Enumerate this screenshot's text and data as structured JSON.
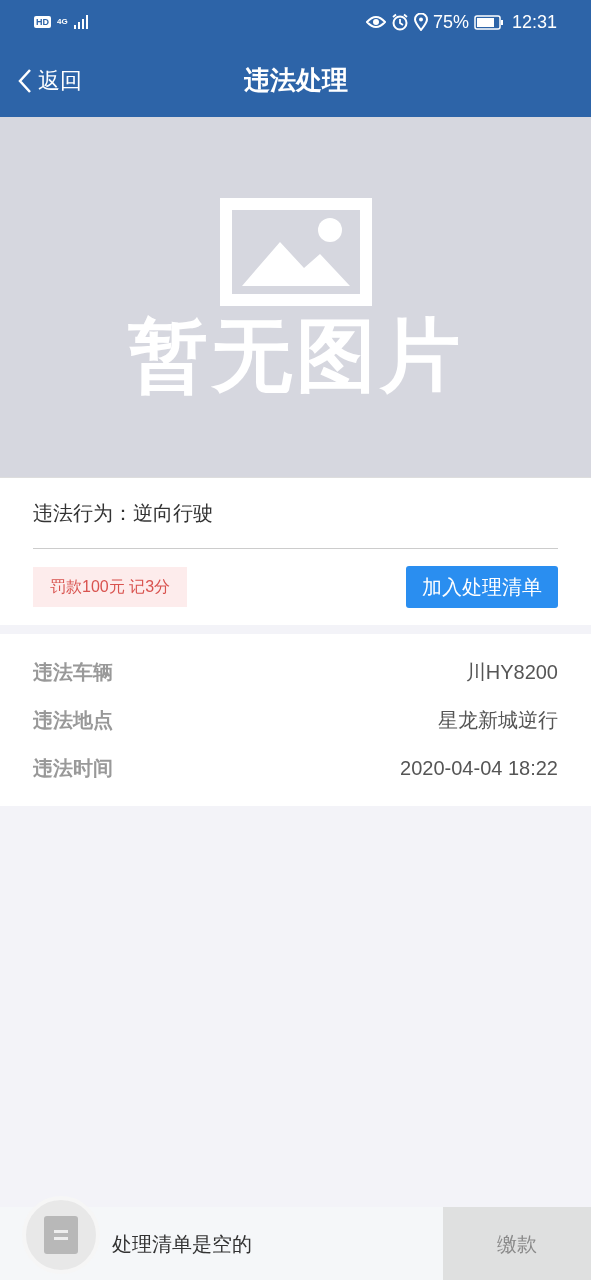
{
  "status_bar": {
    "hd_label": "HD",
    "network": "4G",
    "battery_text": "75%",
    "time": "12:31"
  },
  "nav": {
    "back_label": "返回",
    "title": "违法处理"
  },
  "image_placeholder": {
    "caption": "暂无图片"
  },
  "violation": {
    "behavior_label": "违法行为：",
    "behavior_value": "逆向行驶",
    "penalty": "罚款100元 记3分",
    "add_button": "加入处理清单"
  },
  "details": [
    {
      "label": "违法车辆",
      "value": "川HY8200"
    },
    {
      "label": "违法地点",
      "value": "星龙新城逆行"
    },
    {
      "label": "违法时间",
      "value": "2020-04-04 18:22"
    }
  ],
  "bottom_bar": {
    "cart_text": "处理清单是空的",
    "pay_button": "缴款",
    "pay_disabled": true
  }
}
